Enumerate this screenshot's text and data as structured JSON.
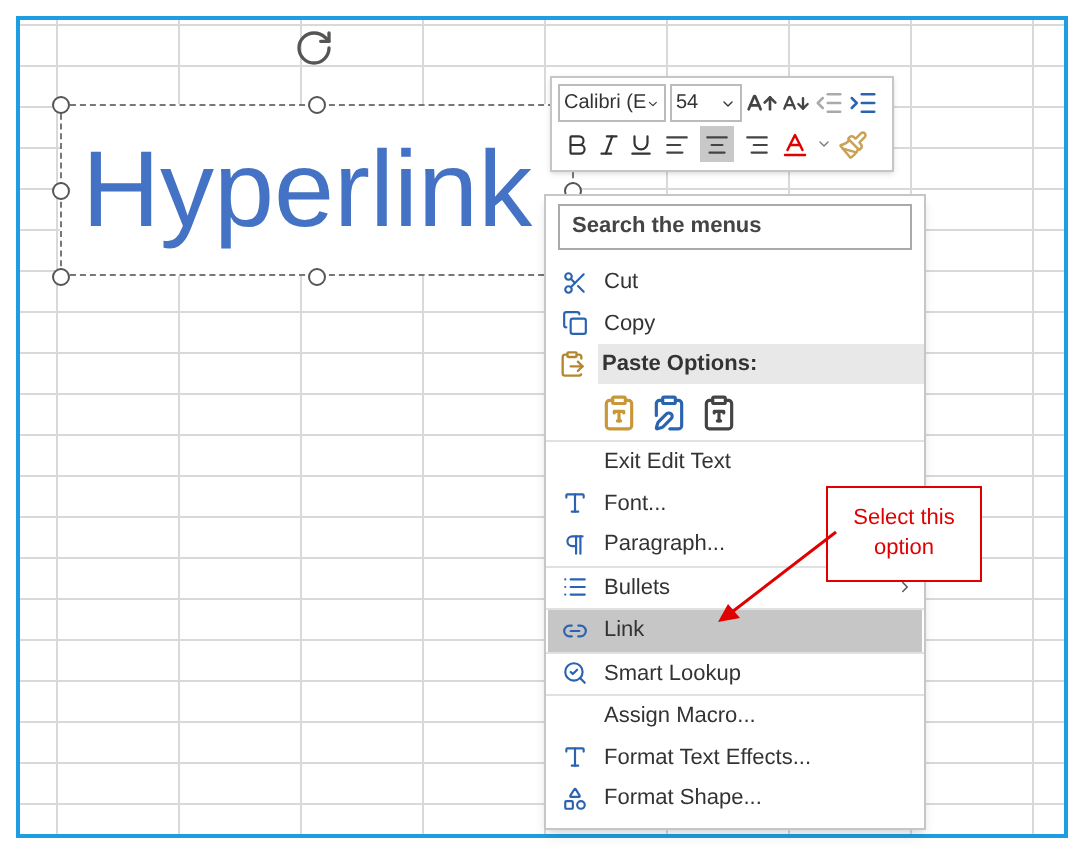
{
  "text_box": {
    "text": "Hyperlink"
  },
  "mini_toolbar": {
    "font": "Calibri (E",
    "size": "54",
    "align": [
      {
        "selected": false
      },
      {
        "selected": true
      },
      {
        "selected": false
      }
    ]
  },
  "context_menu": {
    "search": {
      "placeholder": "Search the menus"
    },
    "items": [
      {
        "kind": "item",
        "label": "Cut",
        "selected": false
      },
      {
        "kind": "item",
        "label": "Copy",
        "selected": false
      },
      {
        "kind": "header",
        "label": "Paste Options:"
      },
      {
        "kind": "paste_icons"
      },
      {
        "kind": "item",
        "label": "Exit Edit Text",
        "selected": false
      },
      {
        "kind": "item",
        "label": "Font...",
        "selected": false
      },
      {
        "kind": "item",
        "label": "Paragraph...",
        "selected": false
      },
      {
        "kind": "item",
        "label": "Bullets",
        "selected": false,
        "submenu": true
      },
      {
        "kind": "item",
        "label": "Link",
        "selected": true
      },
      {
        "kind": "item",
        "label": "Smart Lookup",
        "selected": false
      },
      {
        "kind": "item",
        "label": "Assign Macro...",
        "selected": false
      },
      {
        "kind": "item",
        "label": "Format Text Effects...",
        "selected": false
      },
      {
        "kind": "item",
        "label": "Format Shape...",
        "selected": false
      }
    ]
  },
  "callout": {
    "text": "Select this option"
  }
}
